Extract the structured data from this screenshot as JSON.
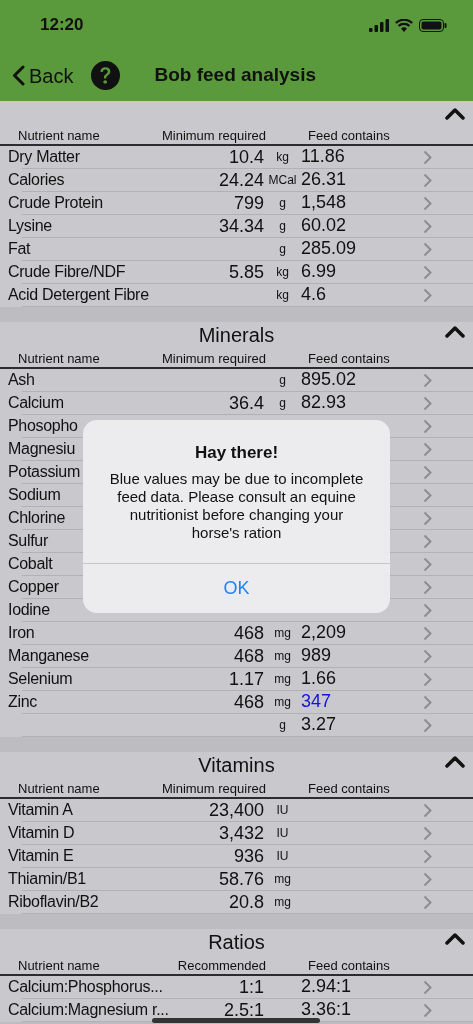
{
  "status_bar": {
    "time": "12:20"
  },
  "nav": {
    "back": "Back",
    "title": "Bob feed analysis"
  },
  "sections": [
    {
      "expanded": true,
      "columns": [
        "Nutrient name",
        "Minimum required",
        "Feed contains"
      ],
      "rows": [
        {
          "name": "Dry Matter",
          "required": "10.4",
          "unit": "kg",
          "contains": "11.86",
          "flagged": false
        },
        {
          "name": "Calories",
          "required": "24.24",
          "unit": "MCal",
          "contains": "26.31",
          "flagged": false
        },
        {
          "name": "Crude Protein",
          "required": "799",
          "unit": "g",
          "contains": "1,548",
          "flagged": false
        },
        {
          "name": "Lysine",
          "required": "34.34",
          "unit": "g",
          "contains": "60.02",
          "flagged": false
        },
        {
          "name": "Fat",
          "unit": "g",
          "contains": "285.09",
          "flagged": false
        },
        {
          "name": "Crude Fibre/NDF",
          "required": "5.85",
          "unit": "kg",
          "contains": "6.99",
          "flagged": false
        },
        {
          "name": "Acid Detergent Fibre",
          "unit": "kg",
          "contains": "4.6",
          "flagged": false
        }
      ]
    },
    {
      "title": "Minerals",
      "expanded": true,
      "columns": [
        "Nutrient name",
        "Minimum required",
        "Feed contains"
      ],
      "rows": [
        {
          "name": "Ash",
          "unit": "g",
          "contains": "895.02",
          "flagged": false
        },
        {
          "name": "Calcium",
          "required": "36.4",
          "unit": "g",
          "contains": "82.93",
          "flagged": false
        },
        {
          "name": "Phosopho"
        },
        {
          "name": "Magnesiu"
        },
        {
          "name": "Potassium"
        },
        {
          "name": "Sodium"
        },
        {
          "name": "Chlorine"
        },
        {
          "name": "Sulfur"
        },
        {
          "name": "Cobalt"
        },
        {
          "name": "Copper"
        },
        {
          "name": "Iodine"
        },
        {
          "name": "Iron",
          "required": "468",
          "unit": "mg",
          "contains": "2,209",
          "flagged": false
        },
        {
          "name": "Manganese",
          "required": "468",
          "unit": "mg",
          "contains": "989",
          "flagged": false
        },
        {
          "name": "Selenium",
          "required": "1.17",
          "unit": "mg",
          "contains": "1.66",
          "flagged": false
        },
        {
          "name": "Zinc",
          "required": "468",
          "unit": "mg",
          "contains": "347",
          "flagged": true
        },
        {
          "unit": "g",
          "contains": "3.27",
          "flagged": false
        }
      ]
    },
    {
      "title": "Vitamins",
      "expanded": true,
      "columns": [
        "Nutrient name",
        "Minimum required",
        "Feed contains"
      ],
      "rows": [
        {
          "name": "Vitamin A",
          "required": "23,400",
          "unit": "IU"
        },
        {
          "name": "Vitamin D",
          "required": "3,432",
          "unit": "IU"
        },
        {
          "name": "Vitamin E",
          "required": "936",
          "unit": "IU"
        },
        {
          "name": "Thiamin/B1",
          "required": "58.76",
          "unit": "mg"
        },
        {
          "name": "Riboflavin/B2",
          "required": "20.8",
          "unit": "mg"
        }
      ]
    },
    {
      "title": "Ratios",
      "expanded": true,
      "columns": [
        "Nutrient name",
        "Recommended",
        "Feed contains"
      ],
      "rows": [
        {
          "name": "Calcium:Phosphorus...",
          "required": "1:1",
          "contains": "2.94:1",
          "flagged": false
        },
        {
          "name": "Calcium:Magnesium r...",
          "required": "2.5:1",
          "contains": "3.36:1",
          "flagged": false
        }
      ]
    }
  ],
  "alert": {
    "title": "Hay there!",
    "message": "Blue values may be due to incomplete feed data. Please consult an equine nutritionist before changing your horse's ration",
    "button": "OK"
  }
}
